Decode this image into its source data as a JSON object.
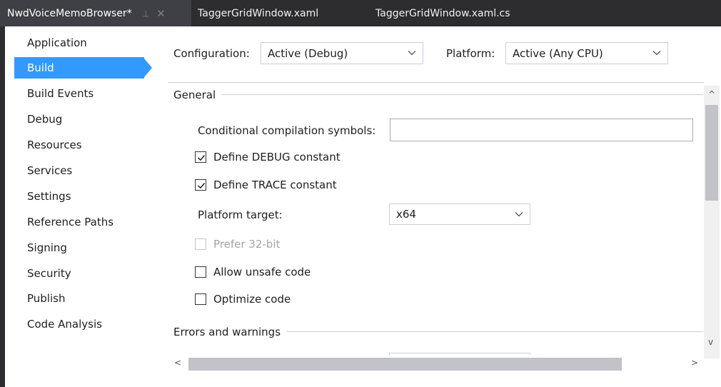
{
  "tabs": {
    "active": "NwdVoiceMemoBrowser*",
    "pin_glyph": "⊣",
    "close_glyph": "✕",
    "second": "TaggerGridWindow.xaml",
    "third": "TaggerGridWindow.xaml.cs"
  },
  "nav": {
    "items": [
      {
        "label": "Application"
      },
      {
        "label": "Build",
        "selected": true
      },
      {
        "label": "Build Events"
      },
      {
        "label": "Debug"
      },
      {
        "label": "Resources"
      },
      {
        "label": "Services"
      },
      {
        "label": "Settings"
      },
      {
        "label": "Reference Paths"
      },
      {
        "label": "Signing"
      },
      {
        "label": "Security"
      },
      {
        "label": "Publish"
      },
      {
        "label": "Code Analysis"
      }
    ]
  },
  "config": {
    "configuration_label": "Configuration:",
    "configuration_value": "Active (Debug)",
    "platform_label": "Platform:",
    "platform_value": "Active (Any CPU)"
  },
  "general": {
    "title": "General",
    "conditional_symbols_label": "Conditional compilation symbols:",
    "conditional_symbols_value": "",
    "define_debug": {
      "label": "Define DEBUG constant",
      "checked": true
    },
    "define_trace": {
      "label": "Define TRACE constant",
      "checked": true
    },
    "platform_target_label": "Platform target:",
    "platform_target_value": "x64",
    "prefer_32bit": {
      "label": "Prefer 32-bit",
      "checked": false,
      "disabled": true
    },
    "allow_unsafe": {
      "label": "Allow unsafe code",
      "checked": false
    },
    "optimize": {
      "label": "Optimize code",
      "checked": false
    }
  },
  "errors": {
    "title": "Errors and warnings"
  },
  "scroll": {
    "up": "^",
    "down": "v",
    "left": "<",
    "right": ">"
  },
  "colors": {
    "selection": "#3399ff",
    "tab_bg": "#2d2d30"
  }
}
